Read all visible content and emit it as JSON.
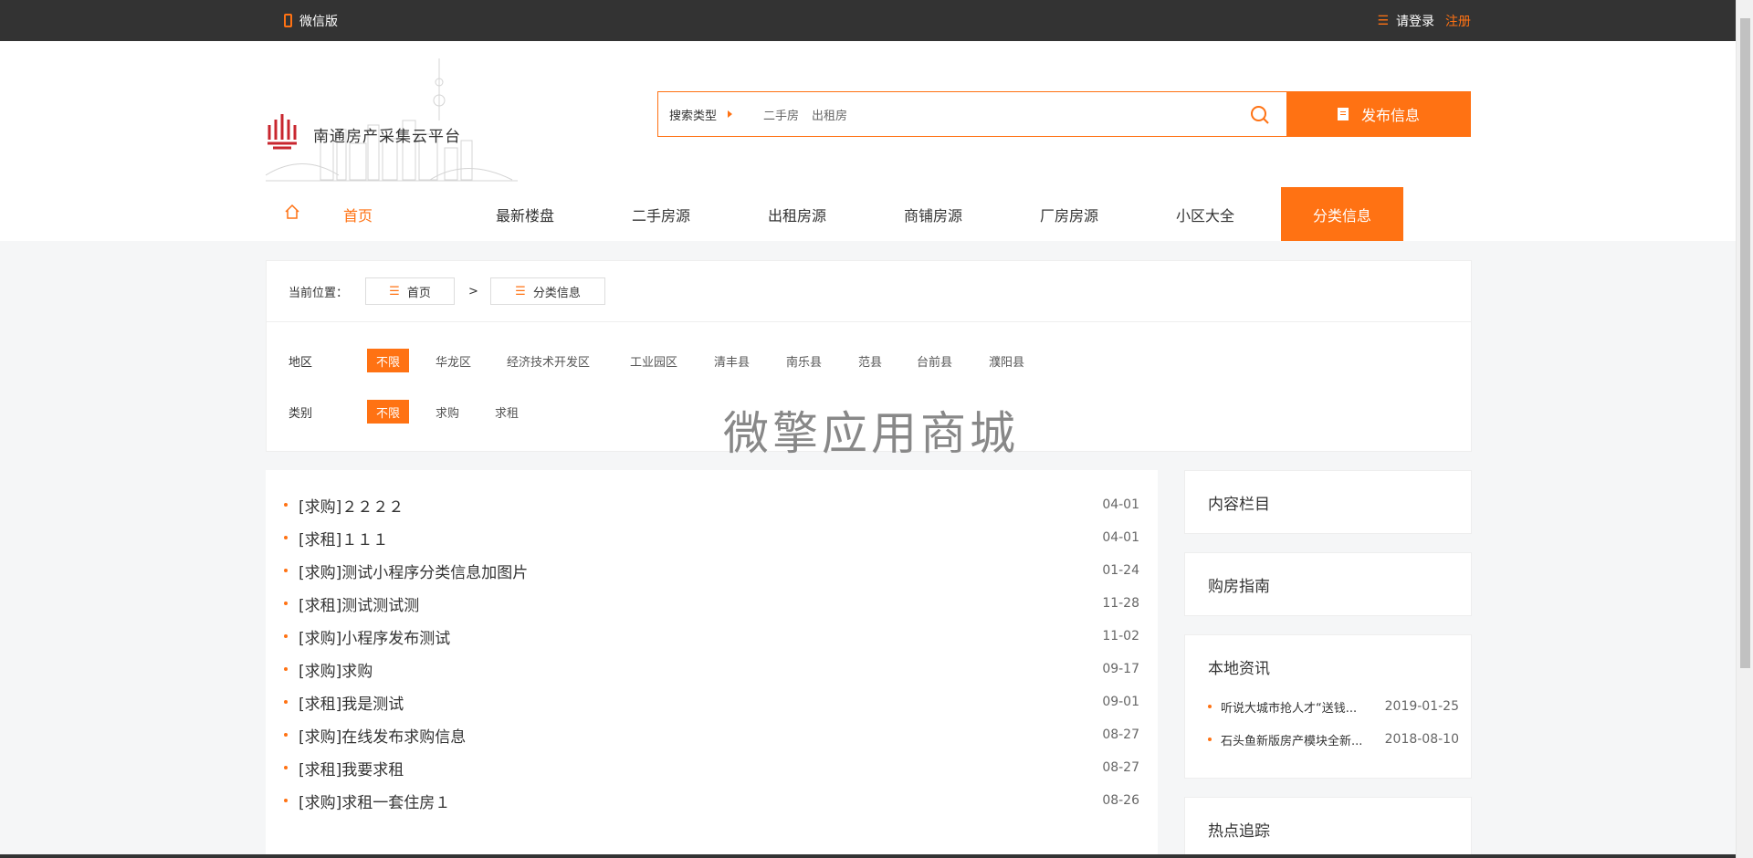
{
  "topbar": {
    "wechat_label": "微信版",
    "login_label": "请登录",
    "register_label": "注册"
  },
  "brand": {
    "site_name": "南通房产采集云平台"
  },
  "search": {
    "type_label": "搜索类型",
    "options": [
      "二手房",
      "出租房"
    ],
    "publish_label": "发布信息"
  },
  "nav": {
    "items": [
      "首页",
      "最新楼盘",
      "二手房源",
      "出租房源",
      "商铺房源",
      "厂房房源",
      "小区大全",
      "分类信息"
    ]
  },
  "breadcrumb": {
    "label": "当前位置：",
    "home": "首页",
    "separator": ">",
    "current": "分类信息"
  },
  "filters": {
    "region": {
      "label": "地区",
      "options": [
        "不限",
        "华龙区",
        "经济技术开发区",
        "工业园区",
        "清丰县",
        "南乐县",
        "范县",
        "台前县",
        "濮阳县"
      ]
    },
    "category": {
      "label": "类别",
      "options": [
        "不限",
        "求购",
        "求租"
      ]
    }
  },
  "watermark": "微擎应用商城",
  "listings": [
    {
      "title": "[求购]２２２２",
      "date": "04-01"
    },
    {
      "title": "[求租]１１１",
      "date": "04-01"
    },
    {
      "title": "[求购]测试小程序分类信息加图片",
      "date": "01-24"
    },
    {
      "title": "[求租]测试测试测",
      "date": "11-28"
    },
    {
      "title": "[求购]小程序发布测试",
      "date": "11-02"
    },
    {
      "title": "[求购]求购",
      "date": "09-17"
    },
    {
      "title": "[求租]我是测试",
      "date": "09-01"
    },
    {
      "title": "[求购]在线发布求购信息",
      "date": "08-27"
    },
    {
      "title": "[求租]我要求租",
      "date": "08-27"
    },
    {
      "title": "[求购]求租一套住房１",
      "date": "08-26"
    }
  ],
  "sidebar": {
    "content_column": "内容栏目",
    "buying_guide": "购房指南",
    "local_news": {
      "title": "本地资讯",
      "items": [
        {
          "title": "听说大城市抢人才“送钱...",
          "date": "2019-01-25"
        },
        {
          "title": "石头鱼新版房产模块全新...",
          "date": "2018-08-10"
        }
      ]
    },
    "hot_tracking": "热点追踪"
  },
  "colors": {
    "accent": "#ff7213",
    "topbar": "#333333"
  },
  "icons": [
    "phone-icon",
    "menu-icon",
    "search-icon",
    "document-icon",
    "home-icon",
    "list-icon"
  ]
}
